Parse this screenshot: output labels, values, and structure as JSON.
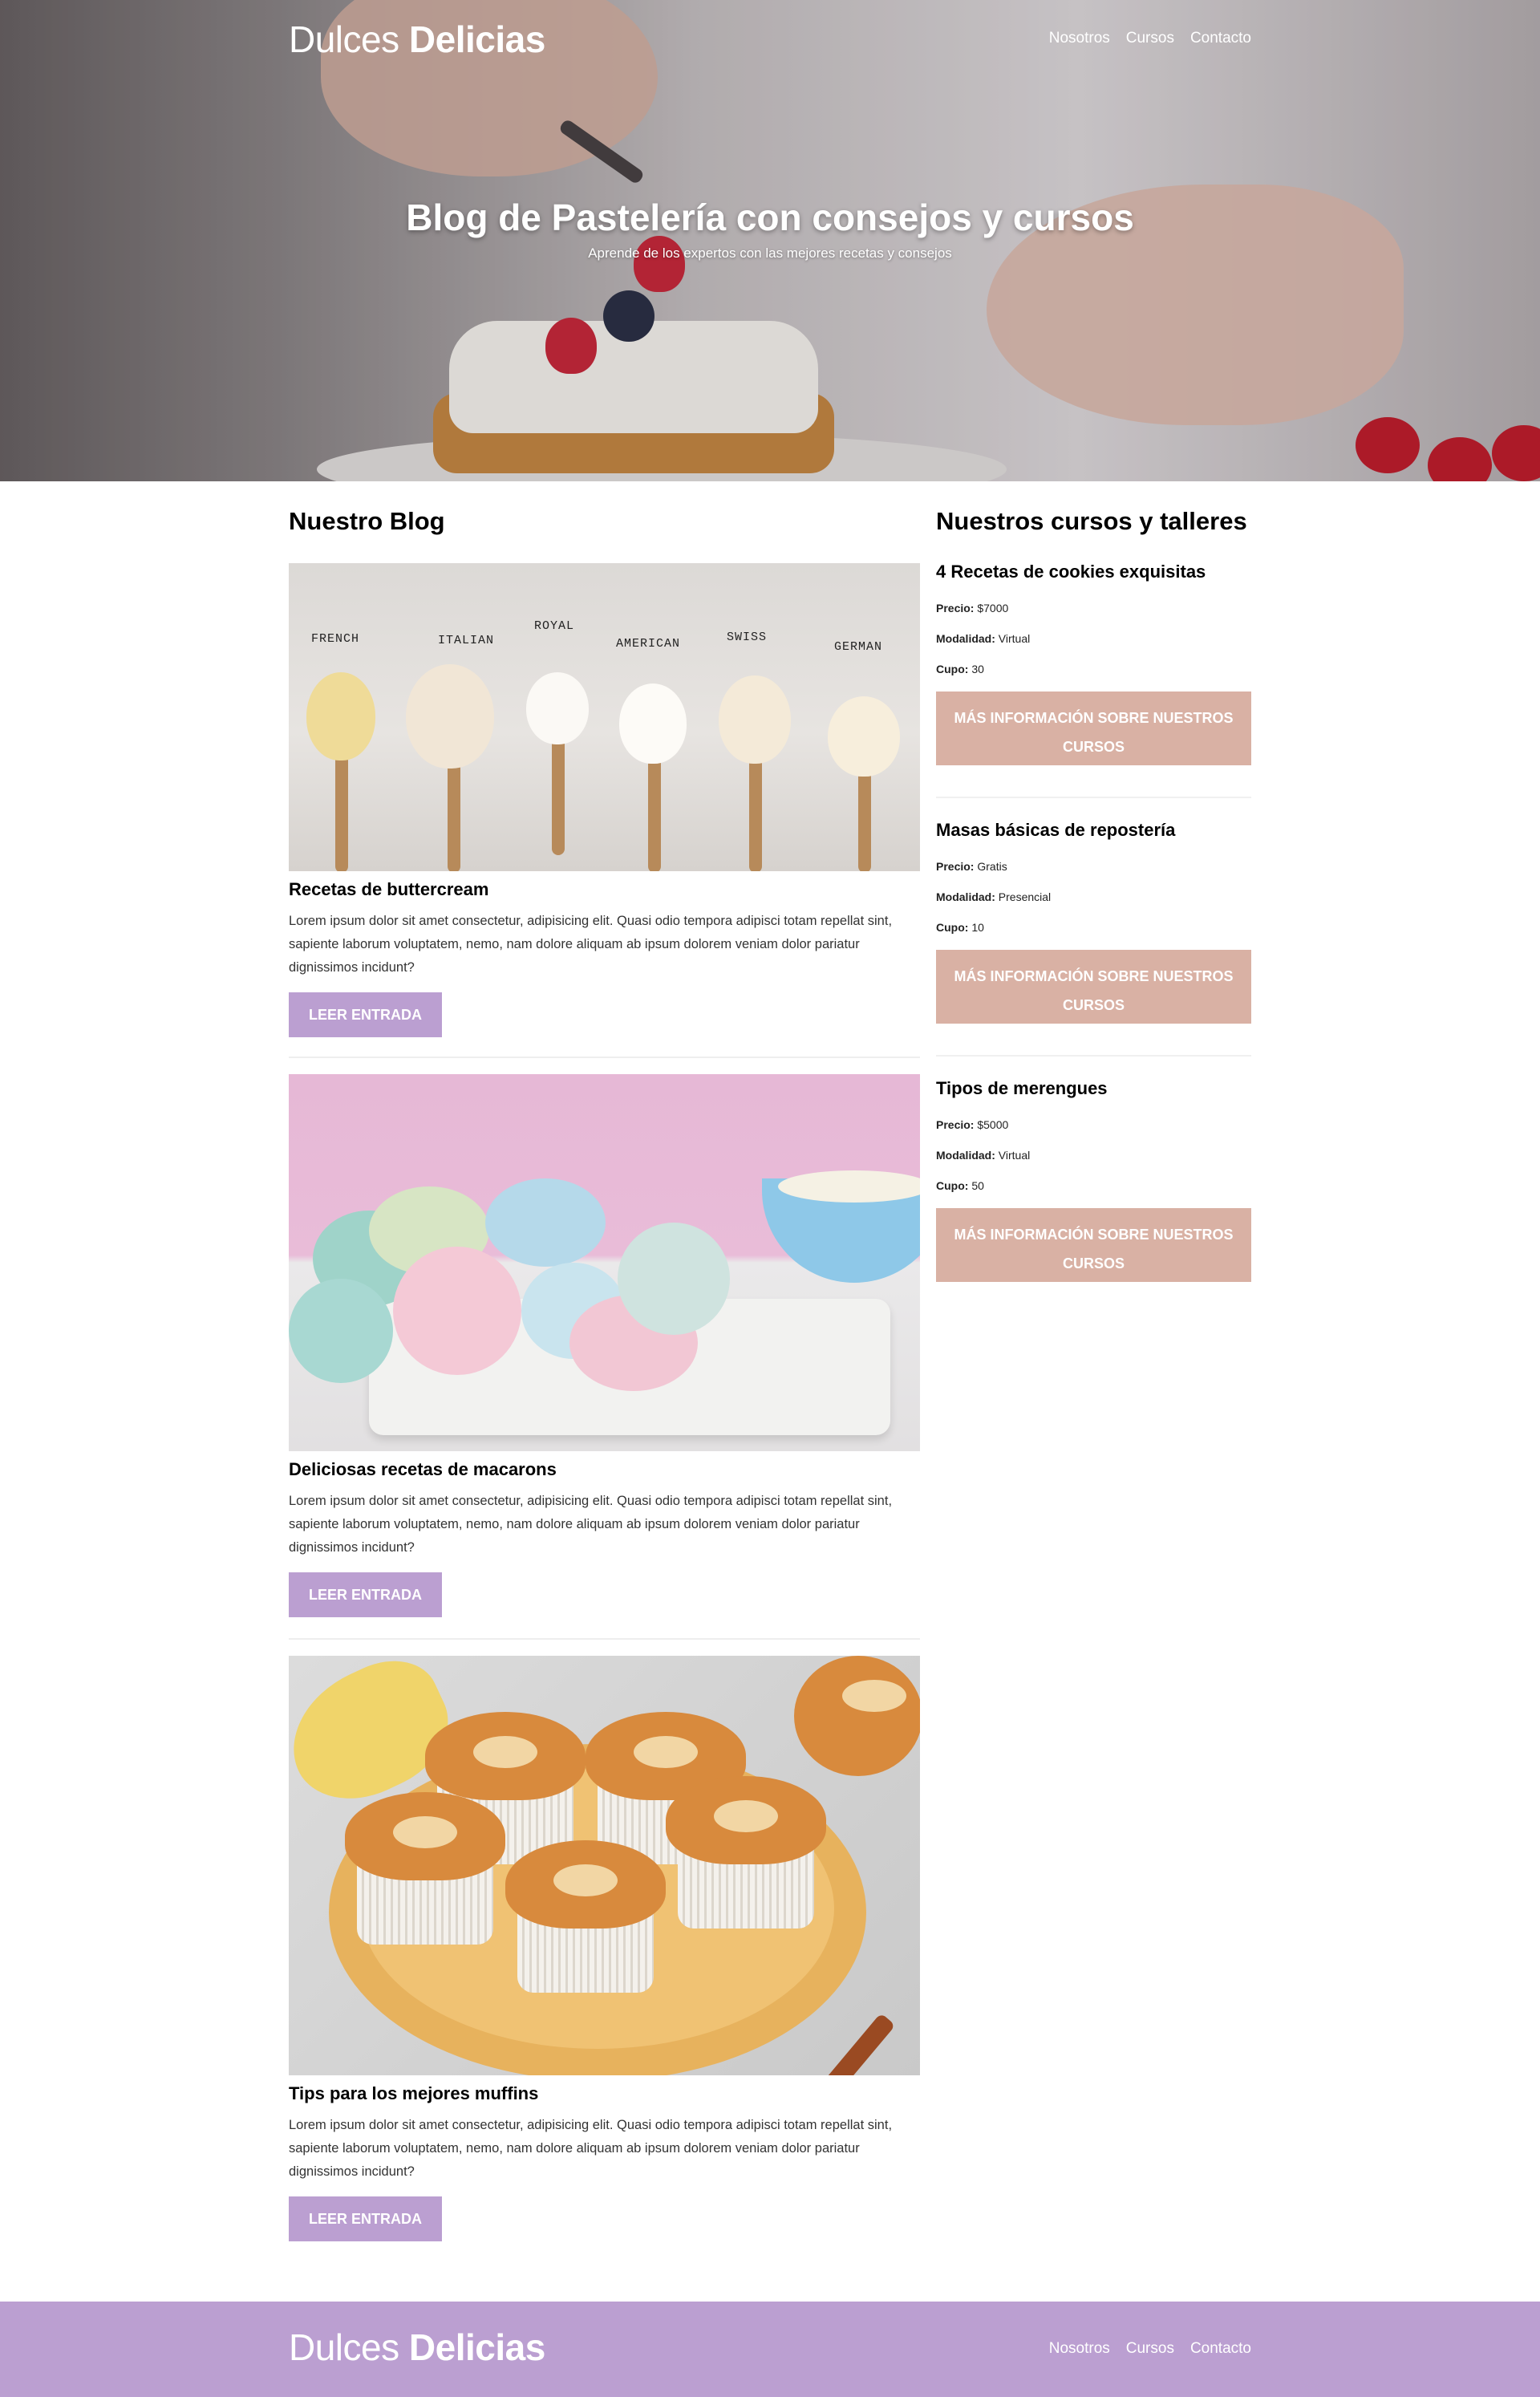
{
  "header": {
    "brand_light": "Dulces",
    "brand_bold": "Delicias",
    "nav": [
      "Nosotros",
      "Cursos",
      "Contacto"
    ]
  },
  "hero": {
    "title": "Blog de Pastelería con consejos y cursos",
    "subtitle": "Aprende de los expertos con las mejores recetas y consejos"
  },
  "blog": {
    "heading": "Nuestro Blog",
    "posts": [
      {
        "title": "Recetas de buttercream",
        "text": "Lorem ipsum dolor sit amet consectetur, adipisicing elit. Quasi odio tempora adipisci totam repellat sint, sapiente laborum voluptatem, nemo, nam dolore aliquam ab ipsum dolorem veniam dolor pariatur dignissimos incidunt?",
        "button": "LEER ENTRADA",
        "image_labels": [
          "FRENCH",
          "ITALIAN",
          "ROYAL",
          "AMERICAN",
          "SWISS",
          "GERMAN"
        ]
      },
      {
        "title": "Deliciosas recetas de macarons",
        "text": "Lorem ipsum dolor sit amet consectetur, adipisicing elit. Quasi odio tempora adipisci totam repellat sint, sapiente laborum voluptatem, nemo, nam dolore aliquam ab ipsum dolorem veniam dolor pariatur dignissimos incidunt?",
        "button": "LEER ENTRADA"
      },
      {
        "title": "Tips para los mejores muffins",
        "text": "Lorem ipsum dolor sit amet consectetur, adipisicing elit. Quasi odio tempora adipisci totam repellat sint, sapiente laborum voluptatem, nemo, nam dolore aliquam ab ipsum dolorem veniam dolor pariatur dignissimos incidunt?",
        "button": "LEER ENTRADA"
      }
    ]
  },
  "courses": {
    "heading": "Nuestros cursos y talleres",
    "field_labels": {
      "price": "Precio:",
      "mode": "Modalidad:",
      "slots": "Cupo:"
    },
    "items": [
      {
        "title": "4 Recetas de cookies exquisitas",
        "price": "$7000",
        "mode": "Virtual",
        "slots": "30",
        "button": "MÁS INFORMACIÓN SOBRE NUESTROS CURSOS"
      },
      {
        "title": "Masas básicas de repostería",
        "price": "Gratis",
        "mode": "Presencial",
        "slots": "10",
        "button": "MÁS INFORMACIÓN SOBRE NUESTROS CURSOS"
      },
      {
        "title": "Tipos de merengues",
        "price": "$5000",
        "mode": "Virtual",
        "slots": "50",
        "button": "MÁS INFORMACIÓN SOBRE NUESTROS CURSOS"
      }
    ]
  },
  "footer": {
    "brand_light": "Dulces",
    "brand_bold": "Delicias",
    "nav": [
      "Nosotros",
      "Cursos",
      "Contacto"
    ]
  },
  "colors": {
    "accent_purple": "#bb9fd1",
    "accent_rose": "#d9b1a4",
    "text": "#000000"
  }
}
